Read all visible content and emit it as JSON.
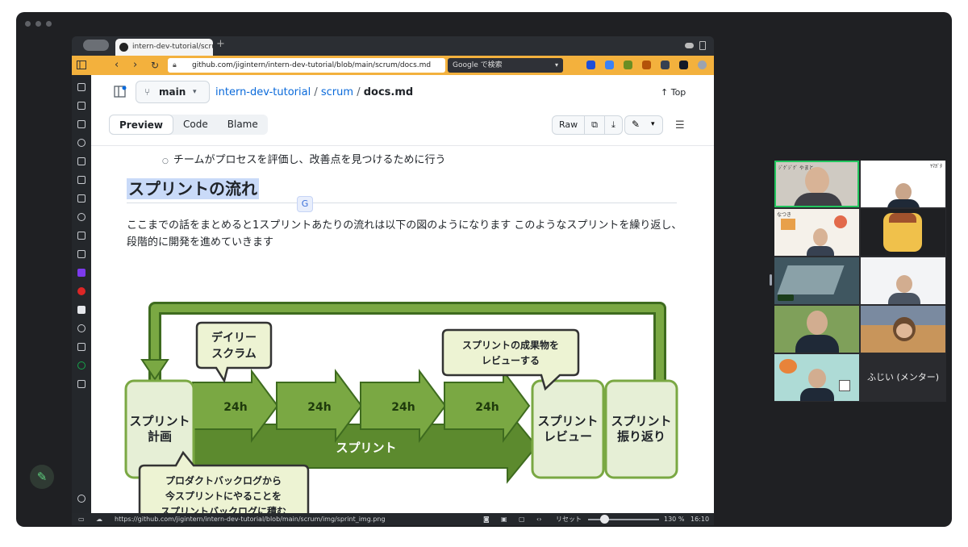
{
  "tab": {
    "title": "intern-dev-tutorial/scrum/"
  },
  "toolbar": {
    "url": "github.com/jigintern/intern-dev-tutorial/blob/main/scrum/docs.md",
    "search_placeholder": "Google で検索"
  },
  "repo": {
    "branch": "main",
    "crumb_repo": "intern-dev-tutorial",
    "crumb_sep": "/",
    "crumb_dir": "scrum",
    "crumb_file": "docs.md",
    "top_label": "Top"
  },
  "file_tabs": [
    "Preview",
    "Code",
    "Blame"
  ],
  "file_actions": {
    "raw_label": "Raw"
  },
  "content": {
    "bullet": "チームがプロセスを評価し、改善点を見つけるために行う",
    "heading": "スプリントの流れ",
    "paragraph": "ここまでの話をまとめると1スプリントあたりの流れは以下の図のようになります このようなスプリントを繰り返し、段階的に開発を進めていきます"
  },
  "diagram": {
    "planning": [
      "スプリント",
      "計画"
    ],
    "daily": [
      "デイリー",
      "スクラム"
    ],
    "review_bubble": [
      "スプリントの成果物を",
      "レビューする"
    ],
    "backlog_bubble": [
      "プロダクトバックログから",
      "今スプリントにやることを",
      "スプリントバックログに積む"
    ],
    "cycles": [
      "24h",
      "24h",
      "24h",
      "24h"
    ],
    "sprint_label": "スプリント",
    "review": [
      "スプリント",
      "レビュー"
    ],
    "retro": [
      "スプリント",
      "振り返り"
    ],
    "colors": {
      "dark": "#5c8a2e",
      "light": "#7aa843",
      "pale": "#e6efd6",
      "bubble": "#edf3d3"
    }
  },
  "statusbar": {
    "link": "https://github.com/jigintern/intern-dev-tutorial/blob/main/scrum/img/sprint_img.png",
    "reset": "リセット",
    "zoom": "130 %",
    "time": "16:10"
  },
  "meeting": {
    "tiles": [
      {
        "label": "ｼﾞｸﾞｼﾞｸﾞ やまと"
      },
      {
        "label": "ﾔﾏｶﾞﾀ"
      },
      {
        "label": "なつき"
      },
      {
        "label": ""
      },
      {
        "label": ""
      },
      {
        "label": ""
      },
      {
        "label": ""
      },
      {
        "label": ""
      },
      {
        "label": ""
      }
    ],
    "name_tile": "ふじい (メンター)"
  }
}
